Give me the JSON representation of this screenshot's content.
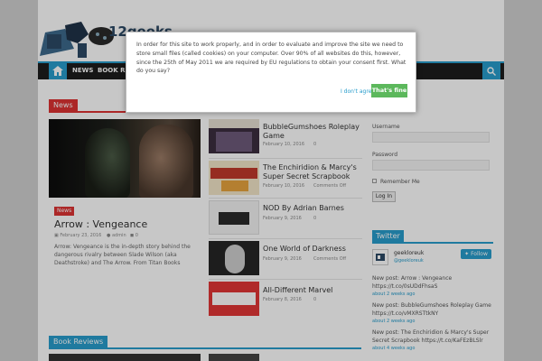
{
  "site": {
    "name": "12geeks"
  },
  "nav": {
    "items": [
      "NEWS",
      "BOOK REVIEWS"
    ]
  },
  "cookie_notice": {
    "text": "In order for this site to work properly, and in order to evaluate and improve the site we need to store small files (called cookies) on your computer. Over 90% of all websites do this, however, since the 25th of May 2011 we are required by EU regulations to obtain your consent first. What do you say?",
    "decline_label": "I don't agree",
    "accept_label": "That's fine"
  },
  "news_section": {
    "title": "News",
    "color": "#dd3333"
  },
  "featured": {
    "badge": "News",
    "title": "Arrow : Vengeance",
    "date": "February 23, 2016",
    "author": "admin",
    "comments": "0",
    "excerpt": "Arrow: Vengeance is the in-depth story behind the dangerous rivalry between Slade Wilson (aka Deathstroke) and The Arrow. From Titan Books"
  },
  "posts": [
    {
      "title": "BubbleGumshoes Roleplay Game",
      "date": "February 10, 2016",
      "comments": "0"
    },
    {
      "title": "The Enchiridion & Marcy's Super Secret Scrapbook",
      "date": "February 10, 2016",
      "comments": "Comments Off"
    },
    {
      "title": "NOD By Adrian Barnes",
      "date": "February 9, 2016",
      "comments": "0"
    },
    {
      "title": "One World of Darkness",
      "date": "February 9, 2016",
      "comments": "Comments Off"
    },
    {
      "title": "All-Different Marvel",
      "date": "February 8, 2016",
      "comments": "0"
    }
  ],
  "book_reviews_section": {
    "title": "Book Reviews"
  },
  "login": {
    "username_label": "Username",
    "password_label": "Password",
    "remember_label": "Remember Me",
    "login_button": "Log In"
  },
  "twitter": {
    "title": "Twitter",
    "name": "geekloreuk",
    "handle": "@geekloreuk",
    "follow_label": "Follow",
    "tweets": [
      {
        "text": "New post: Arrow : Vengeance https://t.co/0sUDdFhsaS",
        "time": "about 2 weeks ago"
      },
      {
        "text": "New post: BubbleGumshoes Roleplay Game https://t.co/vMXRSTtkNY",
        "time": "about 2 weeks ago"
      },
      {
        "text": "New post: The Enchiridion & Marcy's Super Secret Scrapbook https://t.co/KaFEzBLSlr",
        "time": "about 4 weeks ago"
      }
    ]
  }
}
